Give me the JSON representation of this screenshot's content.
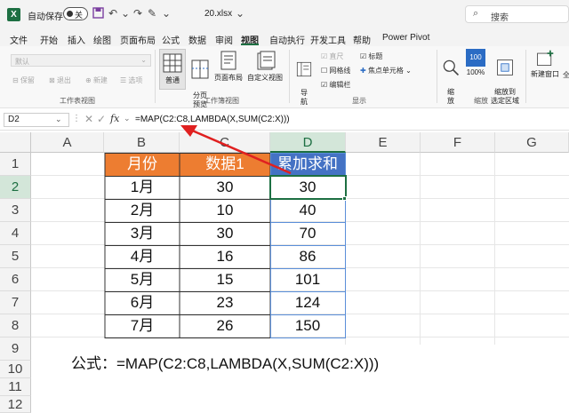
{
  "title_bar": {
    "autosave_label": "自动保存",
    "autosave_state": "关",
    "filename": "20.xlsx",
    "search_placeholder": "搜索"
  },
  "menu": [
    "文件",
    "开始",
    "插入",
    "绘图",
    "页面布局",
    "公式",
    "数据",
    "审阅",
    "视图",
    "自动执行",
    "开发工具",
    "帮助",
    "Power Pivot"
  ],
  "active_menu": "视图",
  "ribbon": {
    "sheet_view": {
      "dropdown_value": "默认",
      "buttons": [
        "保留",
        "退出",
        "新建",
        "选项"
      ],
      "group_label": "工作表视图"
    },
    "workbook_views": {
      "buttons": [
        "普通",
        "分页\n预览",
        "页面布局",
        "自定义视图"
      ],
      "group_label": "工作簿视图"
    },
    "show": {
      "nav": "导\n航",
      "checkboxes": [
        {
          "label": "直尺",
          "checked": true,
          "disabled": true
        },
        {
          "label": "标题",
          "checked": true,
          "disabled": false
        },
        {
          "label": "网格线",
          "checked": false,
          "disabled": false
        },
        {
          "label": "编辑栏",
          "checked": true,
          "disabled": false
        }
      ],
      "focus_cell": "焦点单元格",
      "group_label": "显示"
    },
    "zoom": {
      "buttons": [
        "缩\n放",
        "100%",
        "缩放到\n选定区域"
      ],
      "badge": "100",
      "group_label": "缩放"
    },
    "window": {
      "buttons": [
        "新建窗口",
        "全"
      ]
    }
  },
  "formula_bar": {
    "name_box": "D2",
    "fx": "fx",
    "formula": "=MAP(C2:C8,LAMBDA(X,SUM(C2:X)))"
  },
  "columns": [
    "A",
    "B",
    "C",
    "D",
    "E",
    "F",
    "G"
  ],
  "rows": [
    "1",
    "2",
    "3",
    "4",
    "5",
    "6",
    "7",
    "8",
    "9",
    "10",
    "11",
    "12"
  ],
  "table": {
    "headers": [
      "月份",
      "数据1",
      "累加求和"
    ],
    "rows": [
      [
        "1月",
        "30",
        "30"
      ],
      [
        "2月",
        "10",
        "40"
      ],
      [
        "3月",
        "30",
        "70"
      ],
      [
        "4月",
        "16",
        "86"
      ],
      [
        "5月",
        "15",
        "101"
      ],
      [
        "6月",
        "23",
        "124"
      ],
      [
        "7月",
        "26",
        "150"
      ]
    ]
  },
  "caption": "公式：=MAP(C2:C8,LAMBDA(X,SUM(C2:X)))",
  "colors": {
    "excel_green": "#1d6f42",
    "header_orange": "#ed7d31",
    "header_blue": "#4472c4",
    "arrow_red": "#e02020"
  }
}
